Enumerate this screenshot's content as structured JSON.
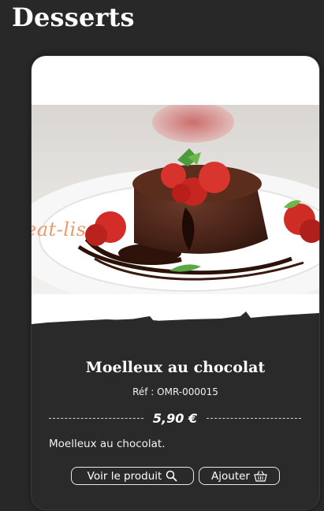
{
  "page": {
    "title": "Desserts"
  },
  "product": {
    "name": "Moelleux au chocolat",
    "reference": "Réf : OMR-000015",
    "price": "5,90 €",
    "description": "Moelleux au chocolat.",
    "watermark": "eat-lis"
  },
  "actions": {
    "view_label": "Voir le produit",
    "view_icon": "search-icon",
    "add_label": "Ajouter",
    "add_icon": "basket-icon"
  },
  "colors": {
    "background": "#282828",
    "card": "#2a2a2a",
    "text": "#ffffff",
    "watermark": "#e88854"
  }
}
